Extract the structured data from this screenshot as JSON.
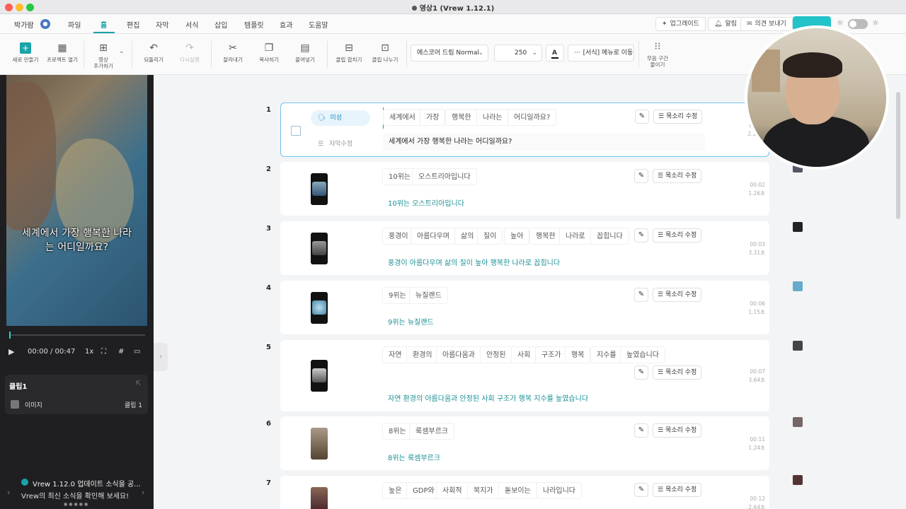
{
  "window": {
    "title": "영상1 (Vrew 1.12.1)"
  },
  "menubar": {
    "user": "박가람",
    "items": [
      "파일",
      "홈",
      "편집",
      "자막",
      "서식",
      "삽입",
      "템플릿",
      "효과",
      "도움말"
    ],
    "active": "홈",
    "upgrade": "업그레이드",
    "alarm": "알림",
    "feedback": "의견 보내기"
  },
  "toolbar": {
    "new": "새로 만들기",
    "open": "프로젝트 열기",
    "add_video_line1": "영상",
    "add_video_line2": "추가하기",
    "undo": "되돌리기",
    "redo": "다시실행",
    "cut": "잘라내기",
    "copy": "복사하기",
    "paste": "붙여넣기",
    "merge": "클립 합치기",
    "split": "클립 나누기",
    "font": "에스코어 드림 Normal",
    "font_size": "250",
    "text_color_letter": "A",
    "format_menu": "[서식] 메뉴로 이동",
    "silence_line1": "무음 구간",
    "silence_line2": "줄이기"
  },
  "preview": {
    "caption_line1": "세계에서 가장 행복한 나라",
    "caption_line2": "는 어디일까요?",
    "current_time": "00:00",
    "total_time": "/ 00:47",
    "speed": "1x"
  },
  "clip_panel": {
    "title": "클립1",
    "row_label": "이미지",
    "row_value": "클립 1"
  },
  "news": {
    "title": "Vrew 1.12.0 업데이트 소식을 공...",
    "subtitle": "Vrew의 최신 소식을 확인해 보세요!"
  },
  "scene1": {
    "voice": "미성",
    "edit_label": "자막수정",
    "subtitle": "세계에서 가장 행복한 나라는 어디일까요?",
    "time1": "00:00",
    "time2": "2.11초"
  },
  "voice_edit_label": "목소리 수정",
  "scenes": [
    {
      "num": "1",
      "words": [
        "세계에서",
        "가장",
        "행복한",
        "나라는",
        "어디일까요?"
      ]
    },
    {
      "num": "2",
      "words": [
        "10위는",
        "오스트리아입니다"
      ],
      "subtitle": "10위는 오스트리아입니다",
      "time1": "00:02",
      "time2": "1.26초"
    },
    {
      "num": "3",
      "words": [
        "풍경이",
        "아름다우며",
        "삶의",
        "질이",
        "높아",
        "행복한",
        "나라로",
        "꼽힙니다"
      ],
      "subtitle": "풍경이 아름다우며 삶의 질이 높아 행복한 나라로 꼽힙니다",
      "time1": "00:03",
      "time2": "3.31초"
    },
    {
      "num": "4",
      "words": [
        "9위는",
        "뉴질랜드"
      ],
      "subtitle": "9위는 뉴질랜드",
      "time1": "00:06",
      "time2": "1.15초"
    },
    {
      "num": "5",
      "words": [
        "자연",
        "환경의",
        "아름다움과",
        "안정된",
        "사회",
        "구조가",
        "행복",
        "지수를",
        "높였습니다"
      ],
      "subtitle": "자연 환경의 아름다움과 안정된 사회 구조가 행복 지수를 높였습니다",
      "time1": "00:07",
      "time2": "3.64초"
    },
    {
      "num": "6",
      "words": [
        "8위는",
        "룩셈부르크"
      ],
      "subtitle": "8위는 룩셈부르크",
      "time1": "00:11",
      "time2": "1.24초"
    },
    {
      "num": "7",
      "words": [
        "높은",
        "GDP와",
        "사회적",
        "복지가",
        "돋보이는",
        "나라입니다"
      ],
      "time1": "00:12",
      "time2": "2.64초"
    }
  ],
  "colors": {
    "accent": "#1aa3a8",
    "selected_border": "#74c3ea",
    "subtitle_text": "#1b8f95"
  }
}
